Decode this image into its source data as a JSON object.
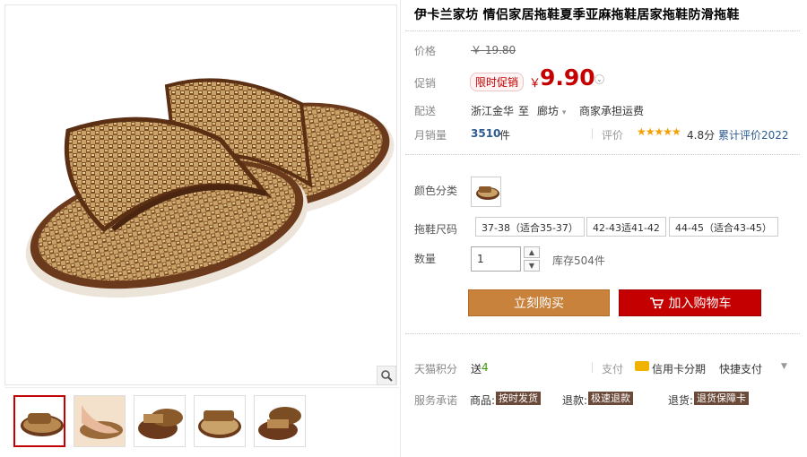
{
  "title": "伊卡兰家坊 情侣家居拖鞋夏季亚麻拖鞋居家拖鞋防滑拖鞋",
  "price": {
    "label": "价格",
    "original": "￥ 19.80"
  },
  "promo": {
    "label": "促销",
    "badge": "限时促销",
    "currency": "￥",
    "price": "9.90"
  },
  "shipping": {
    "label": "配送",
    "from": "浙江金华",
    "to_word": "至",
    "to": "廊坊",
    "fee": "商家承担运费"
  },
  "sales": {
    "label": "月销量",
    "count": "3510",
    "unit": "件",
    "review_label": "评价",
    "stars": "★★★★★",
    "score": "4.8分",
    "review_count": "累计评价2022"
  },
  "color": {
    "label": "颜色分类"
  },
  "size": {
    "label": "拖鞋尺码",
    "options": [
      "37-38（适合35-37）",
      "42-43适41-42",
      "44-45（适合43-45）"
    ]
  },
  "quantity": {
    "label": "数量",
    "value": "1",
    "stock": "库存504件"
  },
  "buttons": {
    "buy": "立刻购买",
    "cart": "加入购物车"
  },
  "points": {
    "label": "天猫积分",
    "send": "送",
    "amount": "4"
  },
  "payment": {
    "label": "支付",
    "credit": "信用卡分期",
    "quick": "快捷支付"
  },
  "service": {
    "label": "服务承诺",
    "goods": "商品:",
    "goods_tag": "按时发货",
    "refund": "退款:",
    "refund_tag": "极速退款",
    "exchange": "退货:",
    "exchange_tag": "退货保障卡"
  },
  "colors": {
    "accent": "#c40000",
    "buy": "#c8823c",
    "link": "#2d5b91"
  }
}
